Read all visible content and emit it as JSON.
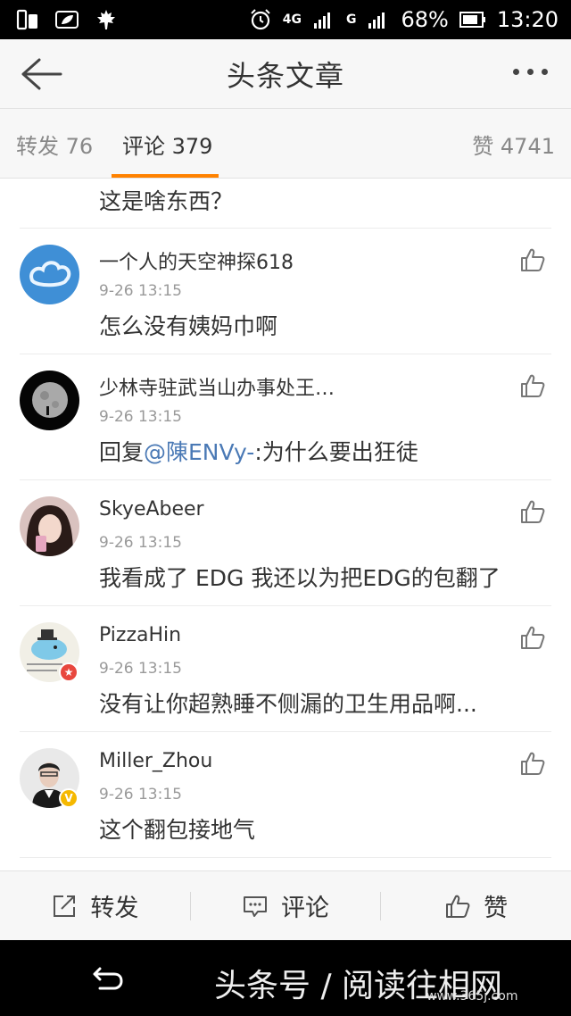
{
  "status_bar": {
    "network": "4G",
    "carrier_g": "G",
    "battery": "68%",
    "time": "13:20"
  },
  "header": {
    "title": "头条文章"
  },
  "tabs": {
    "repost": "转发 76",
    "comment": "评论 379",
    "like": "赞 4741"
  },
  "partial_comment": "这是啥东西？",
  "comments": [
    {
      "user": "一个人的天空神探618",
      "time": "9-26 13:15",
      "text": "怎么没有姨妈巾啊"
    },
    {
      "user": "少林寺驻武当山办事处王…",
      "time": "9-26 13:15",
      "text_prefix": "回复",
      "mention": "@陳ENVy-",
      "text_suffix": ":为什么要出狂徒"
    },
    {
      "user": "SkyeAbeer",
      "time": "9-26 13:15",
      "text": "我看成了 EDG 我还以为把EDG的包翻了"
    },
    {
      "user": "PizzaHin",
      "time": "9-26 13:15",
      "text": "没有让你超熟睡不侧漏的卫生用品啊..."
    },
    {
      "user": "Miller_Zhou",
      "time": "9-26 13:15",
      "text": "这个翻包接地气"
    }
  ],
  "toolbar": {
    "repost": "转发",
    "comment": "评论",
    "like": "赞"
  },
  "watermark": {
    "text": "头条号 / 阅读往相网",
    "url": "www.365j.com"
  },
  "colors": {
    "accent": "#ff8200",
    "mention": "#4a79b5"
  }
}
